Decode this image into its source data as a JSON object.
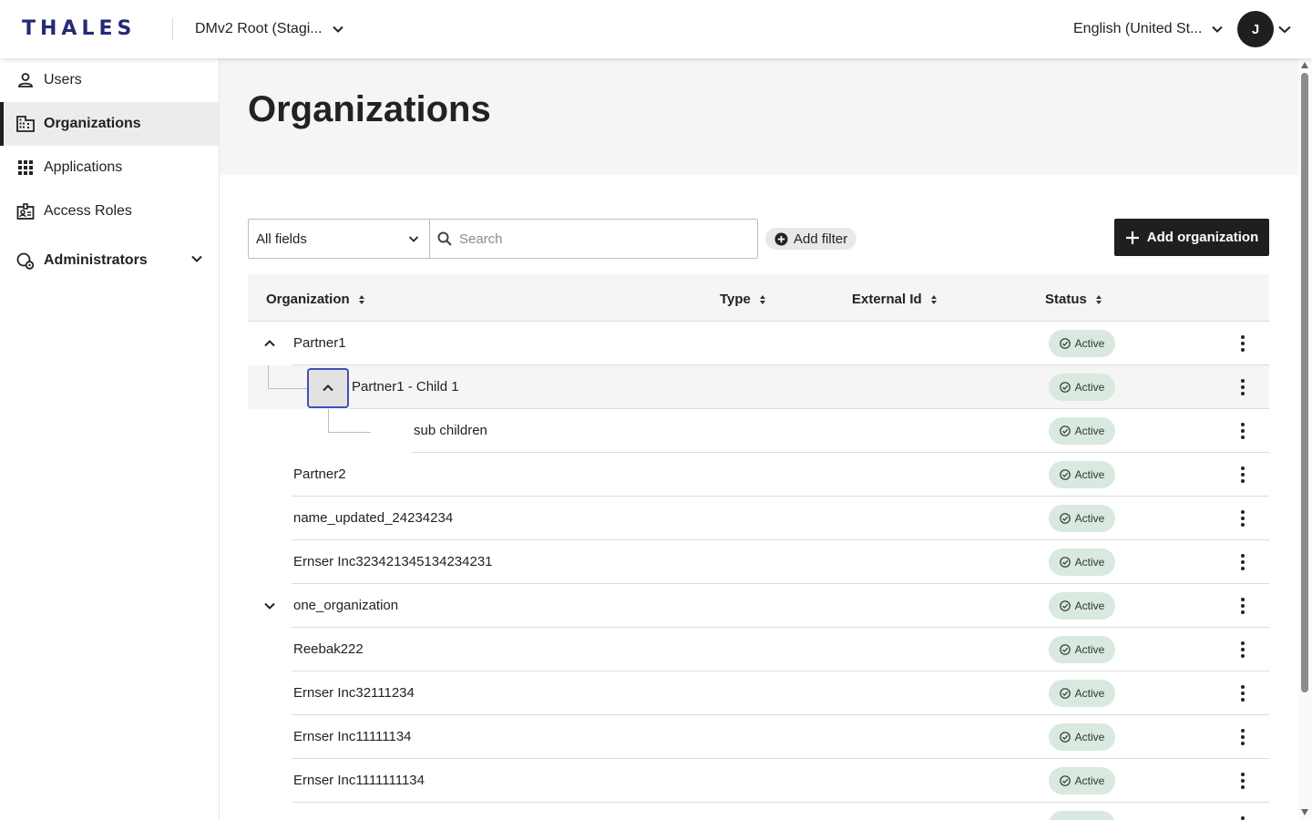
{
  "topbar": {
    "brand": "THALES",
    "tenant": "DMv2 Root (Stagi...",
    "language": "English (United St...",
    "avatar_initial": "J"
  },
  "sidebar": {
    "items": [
      {
        "label": "Users",
        "icon": "user-icon"
      },
      {
        "label": "Organizations",
        "icon": "building-icon",
        "active": true
      },
      {
        "label": "Applications",
        "icon": "grid-icon"
      },
      {
        "label": "Access Roles",
        "icon": "badge-icon"
      },
      {
        "label": "Administrators",
        "icon": "admin-icon",
        "expandable": true
      }
    ]
  },
  "page": {
    "title": "Organizations"
  },
  "toolbar": {
    "field_select": "All fields",
    "search_placeholder": "Search",
    "add_filter": "Add filter",
    "add_organization": "Add organization"
  },
  "table": {
    "columns": [
      "Organization",
      "Type",
      "External Id",
      "Status"
    ],
    "rows": [
      {
        "name": "Partner1",
        "status": "Active"
      },
      {
        "name": "Partner1 - Child 1",
        "status": "Active"
      },
      {
        "name": "sub children",
        "status": "Active"
      },
      {
        "name": "Partner2",
        "status": "Active"
      },
      {
        "name": "name_updated_24234234",
        "status": "Active"
      },
      {
        "name": "Ernser Inc323421345134234231",
        "status": "Active"
      },
      {
        "name": "one_organization",
        "status": "Active"
      },
      {
        "name": "Reebak222",
        "status": "Active"
      },
      {
        "name": "Ernser Inc32111234",
        "status": "Active"
      },
      {
        "name": "Ernser Inc11111134",
        "status": "Active"
      },
      {
        "name": "Ernser Inc1111111134",
        "status": "Active"
      }
    ]
  },
  "colors": {
    "brand": "#242a75",
    "primary_button": "#1f1f1f",
    "status_badge_bg": "#d9e9df",
    "focus_ring": "#3f51b5"
  }
}
